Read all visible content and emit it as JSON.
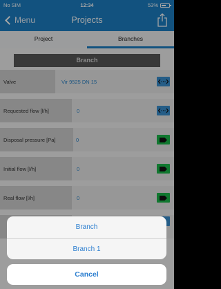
{
  "status": {
    "carrier": "No SIM",
    "time": "12:34",
    "battery": "53%"
  },
  "nav": {
    "back_label": "Menu",
    "title": "Projects"
  },
  "tabs": [
    {
      "label": "Project",
      "active": false
    },
    {
      "label": "Branches",
      "active": true
    }
  ],
  "branch_header": "Branch",
  "rows": [
    {
      "label": "Valve",
      "value": "Vir 9525  DN 15",
      "button": "arrows-icon",
      "button_color": "#3a8fd0"
    },
    {
      "label": "Requested flow [l/h]",
      "value": "0",
      "button": "arrows-icon",
      "button_color": "#3a8fd0"
    },
    {
      "label": "Disposal pressure [Pa]",
      "value": "0",
      "button": "tag-icon",
      "button_color": "#1bb84a"
    },
    {
      "label": "Initial flow [l/h]",
      "value": "0",
      "button": "tag-icon",
      "button_color": "#1bb84a"
    },
    {
      "label": "Real flow [l/h]",
      "value": "0",
      "button": "tag-icon",
      "button_color": "#1bb84a"
    }
  ],
  "sheet": {
    "options": [
      "Branch",
      "Branch 1"
    ],
    "cancel": "Cancel"
  }
}
